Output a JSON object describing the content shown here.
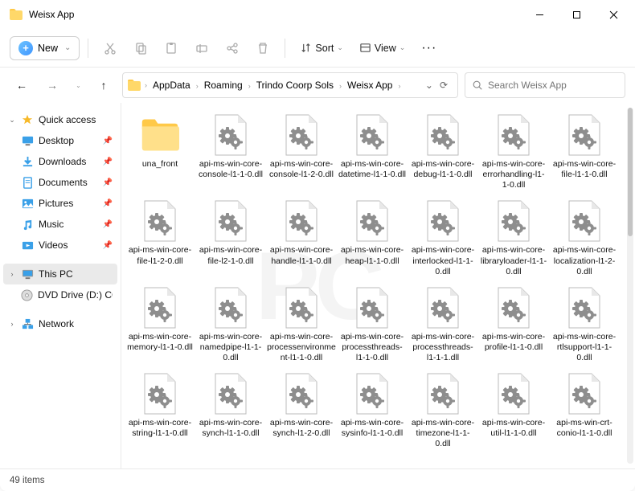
{
  "window": {
    "title": "Weisx App"
  },
  "toolbar": {
    "new_label": "New",
    "sort_label": "Sort",
    "view_label": "View"
  },
  "breadcrumb": {
    "items": [
      "AppData",
      "Roaming",
      "Trindo Coorp Sols",
      "Weisx App"
    ]
  },
  "search": {
    "placeholder": "Search Weisx App"
  },
  "sidebar": {
    "quick": {
      "label": "Quick access"
    },
    "items": [
      {
        "label": "Desktop"
      },
      {
        "label": "Downloads"
      },
      {
        "label": "Documents"
      },
      {
        "label": "Pictures"
      },
      {
        "label": "Music"
      },
      {
        "label": "Videos"
      }
    ],
    "thispc": {
      "label": "This PC"
    },
    "dvd": {
      "label": "DVD Drive (D:) CCCC"
    },
    "network": {
      "label": "Network"
    }
  },
  "files": [
    {
      "name": "una_front",
      "type": "folder"
    },
    {
      "name": "api-ms-win-core-console-l1-1-0.dll",
      "type": "dll"
    },
    {
      "name": "api-ms-win-core-console-l1-2-0.dll",
      "type": "dll"
    },
    {
      "name": "api-ms-win-core-datetime-l1-1-0.dll",
      "type": "dll"
    },
    {
      "name": "api-ms-win-core-debug-l1-1-0.dll",
      "type": "dll"
    },
    {
      "name": "api-ms-win-core-errorhandling-l1-1-0.dll",
      "type": "dll"
    },
    {
      "name": "api-ms-win-core-file-l1-1-0.dll",
      "type": "dll"
    },
    {
      "name": "api-ms-win-core-file-l1-2-0.dll",
      "type": "dll"
    },
    {
      "name": "api-ms-win-core-file-l2-1-0.dll",
      "type": "dll"
    },
    {
      "name": "api-ms-win-core-handle-l1-1-0.dll",
      "type": "dll"
    },
    {
      "name": "api-ms-win-core-heap-l1-1-0.dll",
      "type": "dll"
    },
    {
      "name": "api-ms-win-core-interlocked-l1-1-0.dll",
      "type": "dll"
    },
    {
      "name": "api-ms-win-core-libraryloader-l1-1-0.dll",
      "type": "dll"
    },
    {
      "name": "api-ms-win-core-localization-l1-2-0.dll",
      "type": "dll"
    },
    {
      "name": "api-ms-win-core-memory-l1-1-0.dll",
      "type": "dll"
    },
    {
      "name": "api-ms-win-core-namedpipe-l1-1-0.dll",
      "type": "dll"
    },
    {
      "name": "api-ms-win-core-processenvironment-l1-1-0.dll",
      "type": "dll"
    },
    {
      "name": "api-ms-win-core-processthreads-l1-1-0.dll",
      "type": "dll"
    },
    {
      "name": "api-ms-win-core-processthreads-l1-1-1.dll",
      "type": "dll"
    },
    {
      "name": "api-ms-win-core-profile-l1-1-0.dll",
      "type": "dll"
    },
    {
      "name": "api-ms-win-core-rtlsupport-l1-1-0.dll",
      "type": "dll"
    },
    {
      "name": "api-ms-win-core-string-l1-1-0.dll",
      "type": "dll"
    },
    {
      "name": "api-ms-win-core-synch-l1-1-0.dll",
      "type": "dll"
    },
    {
      "name": "api-ms-win-core-synch-l1-2-0.dll",
      "type": "dll"
    },
    {
      "name": "api-ms-win-core-sysinfo-l1-1-0.dll",
      "type": "dll"
    },
    {
      "name": "api-ms-win-core-timezone-l1-1-0.dll",
      "type": "dll"
    },
    {
      "name": "api-ms-win-core-util-l1-1-0.dll",
      "type": "dll"
    },
    {
      "name": "api-ms-win-crt-conio-l1-1-0.dll",
      "type": "dll"
    }
  ],
  "status": {
    "count": "49 items"
  }
}
